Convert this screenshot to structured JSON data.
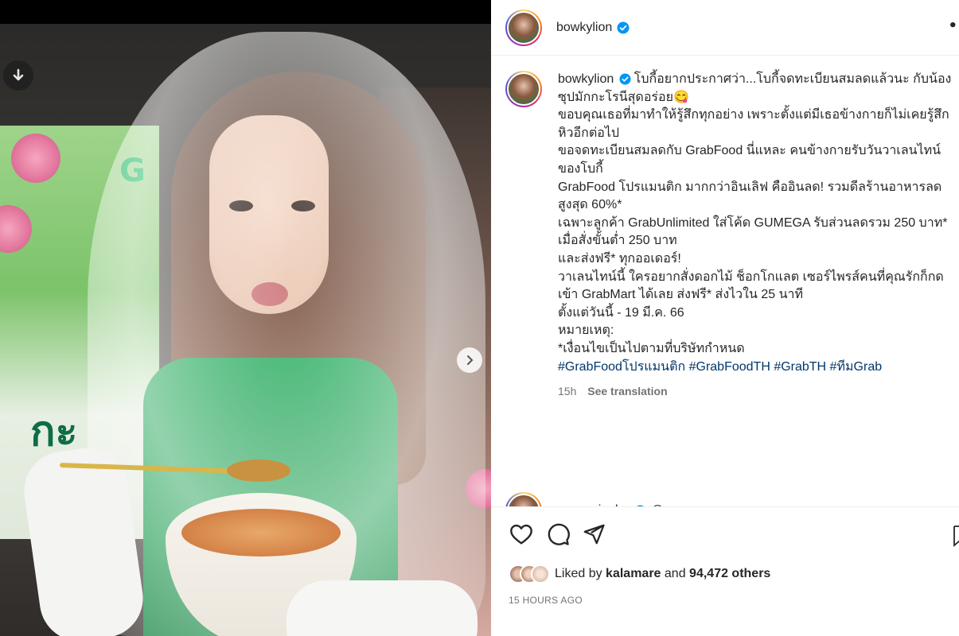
{
  "post": {
    "username": "bowkylion",
    "more_label": "•",
    "photo_description": "Model in bridal veil and green dress holding a bowl of macaroni soup",
    "banner_letter": "G",
    "banner_text": "กะ"
  },
  "caption": {
    "username": "bowkylion",
    "lines": [
      "โบกี้อยากประกาศว่า...โบกี้จดทะเบียนสมลดแล้วนะ กับน้องซุปมักกะโรนีสุดอร่อย😋",
      "ขอบคุณเธอที่มาทำให้รู้สึกทุกอย่าง เพราะตั้งแต่มีเธอข้างกายก็ไม่เคยรู้สึกหิวอีกต่อไป",
      "ขอจดทะเบียนสมลดกับ GrabFood นี่แหละ คนข้างกายรับวันวาเลนไทน์ของโบกี้",
      "",
      "GrabFood โปรแมนติก มากกว่าอินเลิฟ คืออินลด! รวมดีลร้านอาหารลดสูงสุด 60%*",
      "เฉพาะลูกค้า GrabUnlimited ใส่โค้ด GUMEGA รับส่วนลดรวม 250 บาท* เมื่อสั่งขั้นต่ำ 250 บาท",
      "และส่งฟรี* ทุกออเดอร์!",
      "",
      "วาเลนไทน์นี้ ใครอยากสั่งดอกไม้ ช็อกโกแลต เซอร์ไพรส์คนที่คุณรักก็กดเข้า GrabMart ได้เลย ส่งฟรี* ส่งไวใน 25 นาที",
      "ตั้งแต่วันนี้ - 19 มี.ค. 66",
      "",
      "หมายเหตุ:",
      "*เงื่อนไขเป็นไปตามที่บริษัทกำหนด",
      ""
    ],
    "hashtags": "#GrabFoodโปรแมนติก #GrabFoodTH #GrabTH #ทีมGrab",
    "time_ago": "15h",
    "see_translation": "See translation"
  },
  "next_comment": {
    "username": "sanyasinghe",
    "emoji": "😍"
  },
  "likes": {
    "prefix": "Liked by",
    "liker": "kalamare",
    "joiner": "and",
    "others": "94,472 others"
  },
  "timestamp": "15 HOURS AGO",
  "colors": {
    "link": "#00376b",
    "verified": "#0095f6",
    "muted": "#737373"
  }
}
